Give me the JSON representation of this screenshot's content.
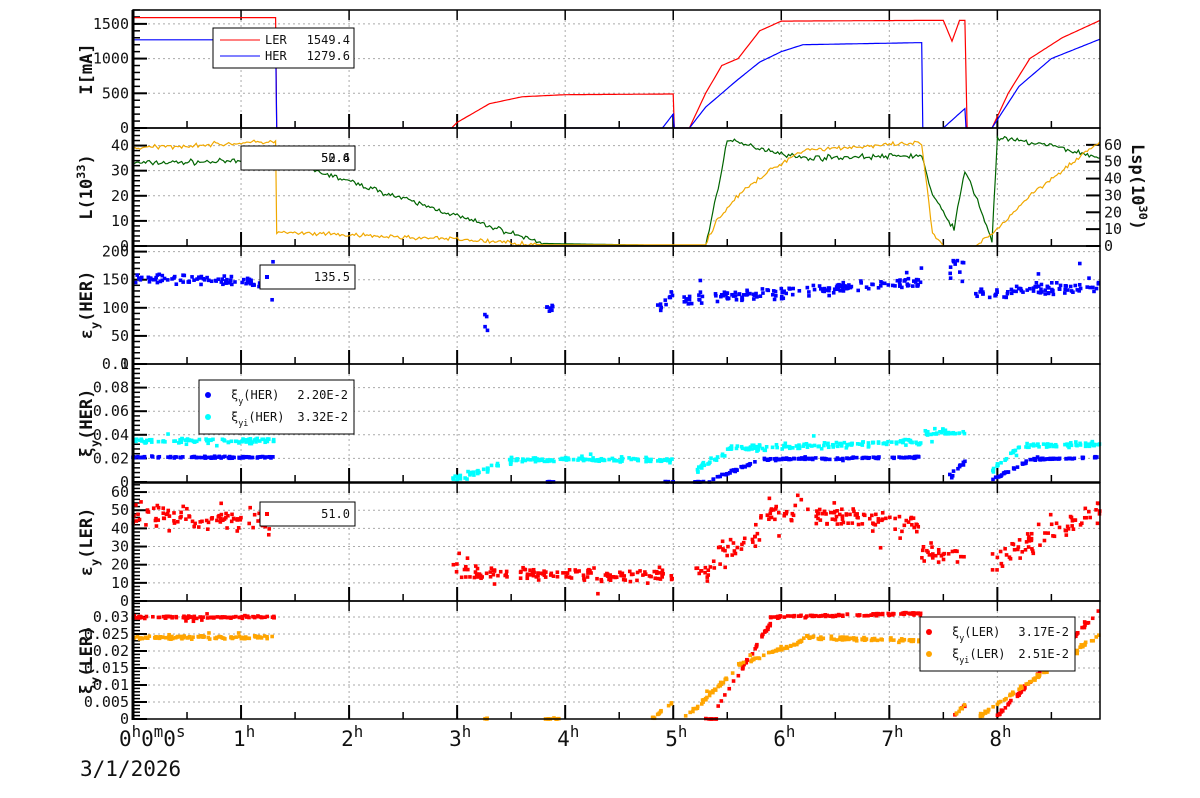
{
  "chart_data": [
    {
      "type": "line",
      "ylabel": [
        {
          "t": "I[mA]"
        }
      ],
      "ylim": [
        0,
        1700
      ],
      "yticks": [
        0,
        500,
        1000,
        1500
      ],
      "series": [
        {
          "name": "LER",
          "color": "#ff0000",
          "legend_value": "1549.4",
          "points": [
            [
              0,
              1590
            ],
            [
              1.32,
              1590
            ],
            [
              1.33,
              0
            ],
            [
              2.95,
              0
            ],
            [
              3.0,
              80
            ],
            [
              3.3,
              350
            ],
            [
              3.6,
              450
            ],
            [
              4.0,
              480
            ],
            [
              5.0,
              490
            ],
            [
              5.01,
              0
            ],
            [
              5.15,
              0
            ],
            [
              5.3,
              500
            ],
            [
              5.45,
              900
            ],
            [
              5.6,
              1000
            ],
            [
              5.8,
              1400
            ],
            [
              6.0,
              1540
            ],
            [
              7.3,
              1550
            ],
            [
              7.5,
              1550
            ],
            [
              7.58,
              1250
            ],
            [
              7.65,
              1550
            ],
            [
              7.7,
              1550
            ],
            [
              7.72,
              0
            ],
            [
              7.95,
              0
            ],
            [
              8.1,
              500
            ],
            [
              8.3,
              1000
            ],
            [
              8.6,
              1300
            ],
            [
              8.95,
              1550
            ]
          ]
        },
        {
          "name": "HER",
          "color": "#0000ff",
          "legend_value": "1279.6",
          "points": [
            [
              0,
              1270
            ],
            [
              1.32,
              1270
            ],
            [
              1.33,
              0
            ],
            [
              4.9,
              0
            ],
            [
              5.0,
              200
            ],
            [
              5.01,
              0
            ],
            [
              5.15,
              0
            ],
            [
              5.3,
              300
            ],
            [
              5.6,
              700
            ],
            [
              5.8,
              950
            ],
            [
              6.0,
              1100
            ],
            [
              6.2,
              1200
            ],
            [
              7.3,
              1230
            ],
            [
              7.31,
              0
            ],
            [
              7.5,
              0
            ],
            [
              7.7,
              280
            ],
            [
              7.71,
              0
            ],
            [
              7.95,
              0
            ],
            [
              8.2,
              600
            ],
            [
              8.5,
              1000
            ],
            [
              8.95,
              1280
            ]
          ]
        }
      ],
      "legend": {
        "entries": [
          "LER",
          "HER"
        ]
      }
    },
    {
      "type": "line",
      "ylabel": [
        {
          "t": "L(10"
        },
        {
          "t": "33",
          "s": "sup"
        },
        {
          "t": ")"
        }
      ],
      "ylim": [
        0,
        47
      ],
      "yticks": [
        0,
        10,
        20,
        30,
        40
      ],
      "y2label": [
        {
          "t": "Lsp(10"
        },
        {
          "t": "30",
          "s": "sup"
        },
        {
          "t": ")"
        }
      ],
      "y2lim": [
        0,
        70
      ],
      "y2ticks": [
        0,
        10,
        20,
        30,
        40,
        50,
        60
      ],
      "series": [
        {
          "name": "L",
          "color": "#006400",
          "axis": "left",
          "legend_value": "50.6",
          "noise": 0.8,
          "points": [
            [
              0,
              33
            ],
            [
              1.32,
              34
            ],
            [
              1.4,
              34
            ],
            [
              3.8,
              1
            ],
            [
              5.3,
              0
            ],
            [
              5.4,
              20
            ],
            [
              5.5,
              42
            ],
            [
              5.9,
              38
            ],
            [
              6.2,
              35
            ],
            [
              7.3,
              36
            ],
            [
              7.4,
              20
            ],
            [
              7.6,
              7
            ],
            [
              7.7,
              30
            ],
            [
              7.8,
              20
            ],
            [
              7.95,
              2
            ],
            [
              8.0,
              43
            ],
            [
              8.5,
              40
            ],
            [
              8.95,
              35
            ]
          ]
        },
        {
          "name": "Lsp",
          "color": "#f0a800",
          "axis": "right",
          "legend_value": "52.4",
          "noise": 1.0,
          "points": [
            [
              0,
              58
            ],
            [
              1.32,
              62
            ],
            [
              1.33,
              8
            ],
            [
              3.0,
              4
            ],
            [
              3.8,
              0.7
            ],
            [
              5.3,
              0.7
            ],
            [
              5.4,
              15
            ],
            [
              5.6,
              30
            ],
            [
              5.9,
              45
            ],
            [
              6.2,
              57
            ],
            [
              7.3,
              61
            ],
            [
              7.4,
              7
            ],
            [
              7.5,
              0
            ],
            [
              7.8,
              0
            ],
            [
              7.95,
              7
            ],
            [
              8.3,
              30
            ],
            [
              8.6,
              45
            ],
            [
              8.95,
              62
            ]
          ]
        }
      ]
    },
    {
      "type": "scatter",
      "ylabel": [
        {
          "t": "ε"
        },
        {
          "t": "y",
          "s": "sub"
        },
        {
          "t": "(HER)"
        }
      ],
      "ylim": [
        0,
        210
      ],
      "yticks": [
        0,
        50,
        100,
        150,
        200
      ],
      "series": [
        {
          "name": "εy(HER)",
          "color": "#0000ff",
          "legend_value": "135.5",
          "segments": [
            [
              0,
              1.32,
              155,
              145,
              8
            ],
            [
              3.25,
              3.3,
              80,
              80,
              15
            ],
            [
              3.8,
              3.9,
              100,
              100,
              8
            ],
            [
              4.85,
              5.0,
              100,
              125,
              12
            ],
            [
              5.1,
              7.3,
              115,
              145,
              8
            ],
            [
              7.55,
              7.7,
              165,
              165,
              20
            ],
            [
              7.8,
              8.95,
              125,
              140,
              9
            ]
          ]
        }
      ]
    },
    {
      "type": "scatter",
      "ylabel": [
        {
          "t": "ξ"
        },
        {
          "t": "y",
          "s": "sub"
        },
        {
          "t": "(HER)"
        }
      ],
      "ylim": [
        0,
        0.1
      ],
      "yticks": [
        0,
        0.02,
        0.04,
        0.06,
        0.08,
        0.1
      ],
      "series": [
        {
          "name": "ξy(HER)",
          "label": [
            {
              "t": "ξ"
            },
            {
              "t": "y",
              "s": "sub"
            },
            {
              "t": "(HER)"
            }
          ],
          "color": "#0000ff",
          "legend_value": "2.20E-2",
          "segments": [
            [
              0,
              1.32,
              0.021,
              0.021,
              0.0006
            ],
            [
              3.8,
              3.9,
              0,
              0,
              0.0003
            ],
            [
              4.9,
              5.0,
              0,
              0,
              0.0003
            ],
            [
              5.2,
              5.35,
              0,
              0,
              0.0003
            ],
            [
              5.35,
              5.8,
              0.002,
              0.018,
              0.0008
            ],
            [
              5.8,
              7.3,
              0.019,
              0.021,
              0.0006
            ],
            [
              7.55,
              7.7,
              0.003,
              0.018,
              0.002
            ],
            [
              7.95,
              8.3,
              0.002,
              0.018,
              0.001
            ],
            [
              8.3,
              8.95,
              0.019,
              0.021,
              0.0006
            ]
          ]
        },
        {
          "name": "ξyi(HER)",
          "label": [
            {
              "t": "ξ"
            },
            {
              "t": "yi",
              "s": "sub"
            },
            {
              "t": "(HER)"
            }
          ],
          "color": "#00ffff",
          "legend_value": "3.32E-2",
          "segments": [
            [
              0,
              1.32,
              0.035,
              0.035,
              0.0015
            ],
            [
              2.95,
              3.5,
              0.002,
              0.017,
              0.002
            ],
            [
              3.5,
              5.0,
              0.019,
              0.019,
              0.0015
            ],
            [
              5.2,
              5.5,
              0.01,
              0.025,
              0.002
            ],
            [
              5.5,
              7.3,
              0.028,
              0.034,
              0.002
            ],
            [
              7.3,
              7.7,
              0.042,
              0.042,
              0.002
            ],
            [
              7.95,
              8.2,
              0.01,
              0.03,
              0.002
            ],
            [
              8.2,
              8.95,
              0.031,
              0.032,
              0.0015
            ]
          ]
        }
      ]
    },
    {
      "type": "scatter",
      "ylabel": [
        {
          "t": "ε"
        },
        {
          "t": "y",
          "s": "sub"
        },
        {
          "t": "(LER)"
        }
      ],
      "ylim": [
        0,
        65
      ],
      "yticks": [
        0,
        10,
        20,
        30,
        40,
        50,
        60
      ],
      "series": [
        {
          "name": "εy(LER)",
          "color": "#ff0000",
          "legend_value": "51.0",
          "segments": [
            [
              0,
              1.32,
              47,
              44,
              5
            ],
            [
              2.95,
              3.1,
              20,
              18,
              4
            ],
            [
              3.1,
              5.0,
              15,
              14,
              2.5
            ],
            [
              5.2,
              5.4,
              15,
              18,
              4
            ],
            [
              5.4,
              5.8,
              25,
              35,
              5
            ],
            [
              5.8,
              6.2,
              45,
              52,
              5
            ],
            [
              6.2,
              7.3,
              48,
              43,
              4
            ],
            [
              7.3,
              7.7,
              27,
              25,
              4
            ],
            [
              7.95,
              8.95,
              22,
              50,
              5
            ]
          ]
        }
      ]
    },
    {
      "type": "scatter",
      "ylabel": [
        {
          "t": "ξ"
        },
        {
          "t": "y",
          "s": "sub"
        },
        {
          "t": "(LER)"
        }
      ],
      "ylim": [
        0,
        0.0347
      ],
      "yticks": [
        0,
        0.005,
        0.01,
        0.015,
        0.02,
        0.025,
        0.03
      ],
      "series": [
        {
          "name": "ξy(LER)",
          "label": [
            {
              "t": "ξ"
            },
            {
              "t": "y",
              "s": "sub"
            },
            {
              "t": "(LER)"
            }
          ],
          "color": "#ff0000",
          "legend_value": "3.17E-2",
          "segments": [
            [
              0,
              1.32,
              0.03,
              0.03,
              0.0003
            ],
            [
              5.3,
              5.4,
              0,
              0,
              0.0002
            ],
            [
              5.4,
              5.9,
              0.003,
              0.028,
              0.0004
            ],
            [
              5.9,
              7.3,
              0.03,
              0.031,
              0.0003
            ],
            [
              7.6,
              7.7,
              0.001,
              0.004,
              0.0003
            ],
            [
              8.0,
              8.95,
              0.001,
              0.032,
              0.0004
            ]
          ]
        },
        {
          "name": "ξyi(LER)",
          "label": [
            {
              "t": "ξ"
            },
            {
              "t": "yi",
              "s": "sub"
            },
            {
              "t": "(LER)"
            }
          ],
          "color": "#ffa500",
          "legend_value": "2.51E-2",
          "segments": [
            [
              0,
              1.32,
              0.024,
              0.024,
              0.0004
            ],
            [
              3.25,
              3.3,
              0,
              0,
              0.0002
            ],
            [
              3.8,
              3.95,
              0,
              0,
              0.0002
            ],
            [
              4.8,
              5.0,
              0,
              0.005,
              0.0003
            ],
            [
              5.1,
              5.6,
              0,
              0.015,
              0.0004
            ],
            [
              5.6,
              6.2,
              0.016,
              0.023,
              0.0004
            ],
            [
              6.2,
              7.3,
              0.024,
              0.023,
              0.0004
            ],
            [
              7.6,
              7.7,
              0.001,
              0.004,
              0.0003
            ],
            [
              7.8,
              8.95,
              0,
              0.025,
              0.0004
            ]
          ]
        }
      ]
    }
  ],
  "xaxis": {
    "range_hours": [
      0,
      8.95
    ],
    "tick_labels": [
      "0^h0^m0^s",
      "1^h",
      "2^h",
      "3^h",
      "4^h",
      "5^h",
      "6^h",
      "7^h",
      "8^h"
    ],
    "date": "3/1/2026"
  }
}
